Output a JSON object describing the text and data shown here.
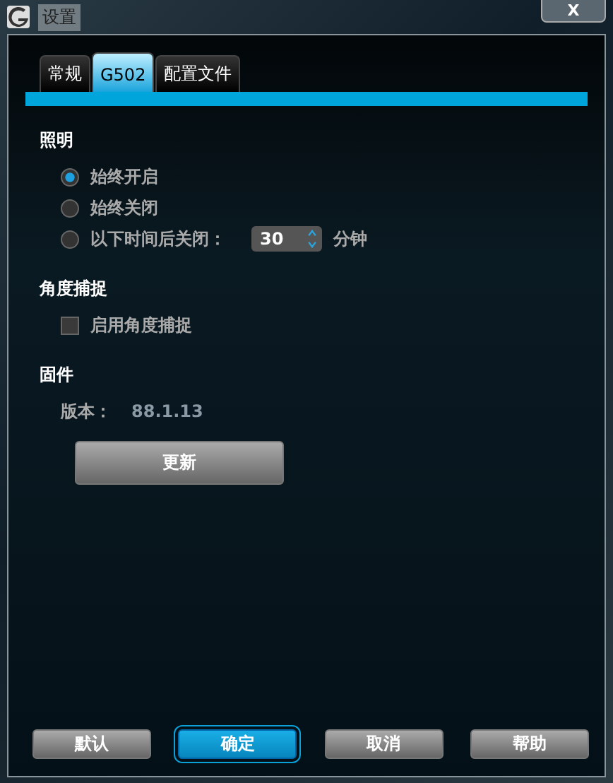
{
  "window": {
    "title": "设置",
    "close": "X"
  },
  "tabs": [
    {
      "label": "常规",
      "selected": false
    },
    {
      "label": "G502",
      "selected": true
    },
    {
      "label": "配置文件",
      "selected": false
    }
  ],
  "lighting": {
    "heading": "照明",
    "options": [
      {
        "label": "始终开启",
        "selected": true
      },
      {
        "label": "始终关闭",
        "selected": false
      },
      {
        "label": "以下时间后关闭：",
        "selected": false
      }
    ],
    "timeout": "30",
    "unit": "分钟"
  },
  "angle_snapping": {
    "heading": "角度捕捉",
    "label": "启用角度捕捉",
    "checked": false
  },
  "firmware": {
    "heading": "固件",
    "version_label": "版本：",
    "version": "88.1.13",
    "update_button": "更新"
  },
  "buttons": [
    {
      "label": "默认",
      "selected": false
    },
    {
      "label": "确定",
      "selected": true
    },
    {
      "label": "取消",
      "selected": false
    },
    {
      "label": "帮助",
      "selected": false
    }
  ]
}
